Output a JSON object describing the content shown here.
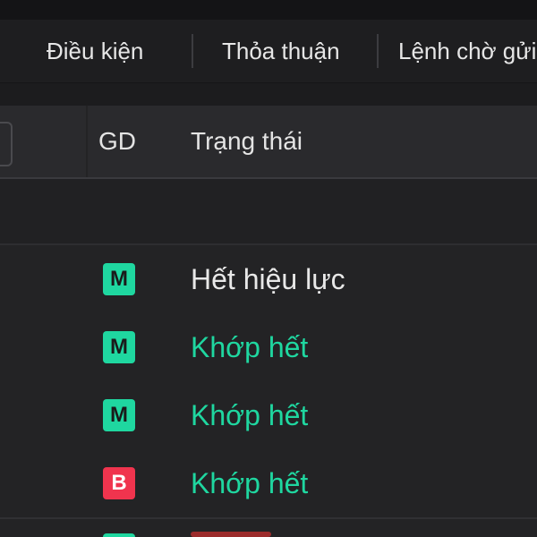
{
  "tabs": [
    {
      "label": "Điều kiện"
    },
    {
      "label": "Thỏa thuận"
    },
    {
      "label": "Lệnh chờ gửi"
    }
  ],
  "table": {
    "columns": {
      "side": "GD",
      "status": "Trạng thái"
    },
    "rows": [
      {
        "side": "M",
        "side_color": "#1fd7a0",
        "status": "Hết hiệu lực",
        "status_color": "#e8e8e8"
      },
      {
        "side": "M",
        "side_color": "#1fd7a0",
        "status": "Khớp hết",
        "status_color": "#1fd7a0"
      },
      {
        "side": "M",
        "side_color": "#1fd7a0",
        "status": "Khớp hết",
        "status_color": "#1fd7a0"
      },
      {
        "side": "B",
        "side_color": "#f0344e",
        "status": "Khớp hết",
        "status_color": "#1fd7a0"
      }
    ]
  },
  "colors": {
    "background": "#1c1c1e",
    "buy_green": "#1fd7a0",
    "sell_red": "#f0344e"
  }
}
